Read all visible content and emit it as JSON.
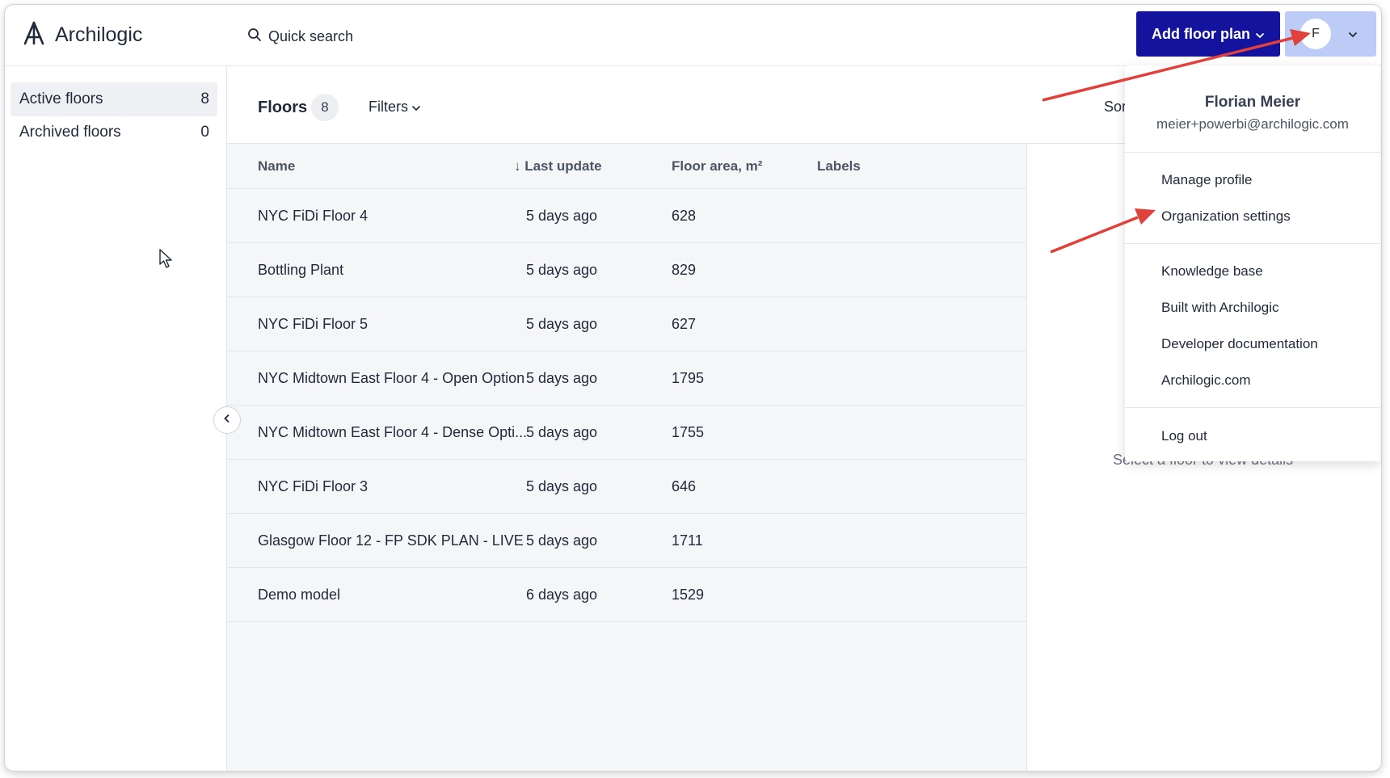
{
  "app": {
    "name": "Archilogic"
  },
  "topbar": {
    "search_label": "Quick search",
    "add_button_label": "Add floor plan",
    "user_initial": "F"
  },
  "sidebar": {
    "items": [
      {
        "label": "Active floors",
        "count": "8"
      },
      {
        "label": "Archived floors",
        "count": "0"
      }
    ]
  },
  "main": {
    "title": "Floors",
    "count": "8",
    "filters_label": "Filters",
    "sort_label": "Sor",
    "details_hint": "Select a floor to view details"
  },
  "table": {
    "columns": [
      "Name",
      "↓ Last update",
      "Floor area, m²",
      "Labels"
    ],
    "rows": [
      {
        "name": "NYC FiDi Floor 4",
        "updated": "5 days ago",
        "area": "628",
        "labels": ""
      },
      {
        "name": "Bottling Plant",
        "updated": "5 days ago",
        "area": "829",
        "labels": ""
      },
      {
        "name": "NYC FiDi Floor 5",
        "updated": "5 days ago",
        "area": "627",
        "labels": ""
      },
      {
        "name": "NYC Midtown East Floor 4 - Open Option",
        "updated": "5 days ago",
        "area": "1795",
        "labels": ""
      },
      {
        "name": "NYC Midtown East Floor 4 - Dense Opti...",
        "updated": "5 days ago",
        "area": "1755",
        "labels": ""
      },
      {
        "name": "NYC FiDi Floor 3",
        "updated": "5 days ago",
        "area": "646",
        "labels": ""
      },
      {
        "name": "Glasgow Floor 12 - FP SDK PLAN - LIVE",
        "updated": "5 days ago",
        "area": "1711",
        "labels": ""
      },
      {
        "name": "Demo model",
        "updated": "6 days ago",
        "area": "1529",
        "labels": ""
      }
    ]
  },
  "user_menu": {
    "name": "Florian Meier",
    "email": "meier+powerbi@archilogic.com",
    "items": [
      "Manage profile",
      "Organization settings",
      "Knowledge base",
      "Built with Archilogic",
      "Developer documentation",
      "Archilogic.com",
      "Log out"
    ]
  },
  "colors": {
    "primary_button": "#14139e",
    "user_button": "#bcccf6",
    "annotation_arrow": "#e0413a"
  },
  "icons": [
    "archilogic-logo-icon",
    "search-icon",
    "chevron-down-icon",
    "chevron-left-icon",
    "mouse-cursor-icon",
    "annotation-arrow"
  ]
}
